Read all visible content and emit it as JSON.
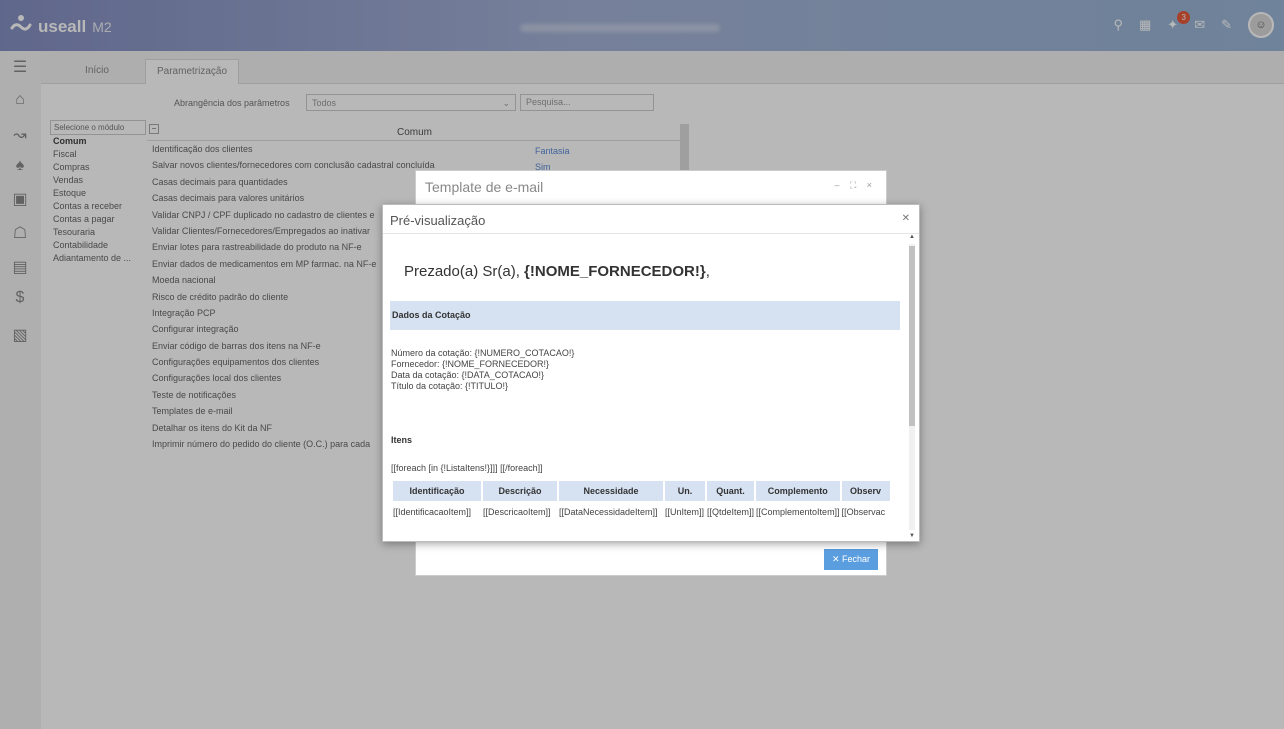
{
  "header": {
    "logo": "useall",
    "product": "M2",
    "notification_count": "3"
  },
  "tabs": [
    {
      "label": "Início"
    },
    {
      "label": "Parametrização"
    }
  ],
  "filter": {
    "label": "Abrangência dos parâmetros",
    "selected": "Todos",
    "search_placeholder": "Pesquisa..."
  },
  "modules": {
    "header": "Selecione o módulo",
    "items": [
      "Comum",
      "Fiscal",
      "Compras",
      "Vendas",
      "Estoque",
      "Contas a receber",
      "Contas a pagar",
      "Tesouraria",
      "Contabilidade",
      "Adiantamento de ..."
    ]
  },
  "params": {
    "group": "Comum",
    "items": [
      "Identificação dos clientes",
      "Salvar novos clientes/fornecedores com conclusão cadastral concluída",
      "Casas decimais para quantidades",
      "Casas decimais para valores unitários",
      "Validar CNPJ / CPF duplicado no cadastro de clientes e",
      "Validar Clientes/Fornecedores/Empregados ao inativar",
      "Enviar lotes para rastreabilidade do produto na NF-e",
      "Enviar dados de medicamentos em MP farmac. na NF-e",
      "Moeda nacional",
      "Risco de crédito padrão do cliente",
      "Integração PCP",
      "Configurar integração",
      "Enviar código de barras dos itens na NF-e",
      "Configurações equipamentos dos clientes",
      "Configurações local dos clientes",
      "Teste de notificações",
      "Templates de e-mail",
      "Detalhar os itens do Kit da NF",
      "Imprimir número do pedido do cliente (O.C.) para cada"
    ],
    "values": [
      "Fantasia",
      "Sim"
    ]
  },
  "template_dialog": {
    "title": "Template de e-mail",
    "controls": "– ⛶ ×",
    "close_label": "✕  Fechar"
  },
  "preview": {
    "title": "Pré-visualização",
    "greeting_prefix": "Prezado(a) Sr(a),",
    "greeting_var": "{!NOME_FORNECEDOR!}",
    "greeting_suffix": ",",
    "section_title": "Dados da Cotação",
    "data_lines": [
      "Número da cotação: {!NUMERO_COTACAO!}",
      "Fornecedor: {!NOME_FORNECEDOR!}",
      "Data da cotação: {!DATA_COTACAO!}",
      "Título da cotação: {!TITULO!}"
    ],
    "items_title": "Itens",
    "foreach_line": "[[foreach [in {!ListaItens!}]]] [[/foreach]]",
    "table": {
      "headers": [
        "Identificação",
        "Descrição",
        "Necessidade",
        "Un.",
        "Quant.",
        "Complemento",
        "Observ"
      ],
      "row": [
        "[[IdentificacaoItem]]",
        "[[DescricaoItem]]",
        "[[DataNecessidadeItem]]",
        "[[UnItem]]",
        "[[QtdeItem]]",
        "[[ComplementoItem]]",
        "[[Observac"
      ]
    }
  }
}
